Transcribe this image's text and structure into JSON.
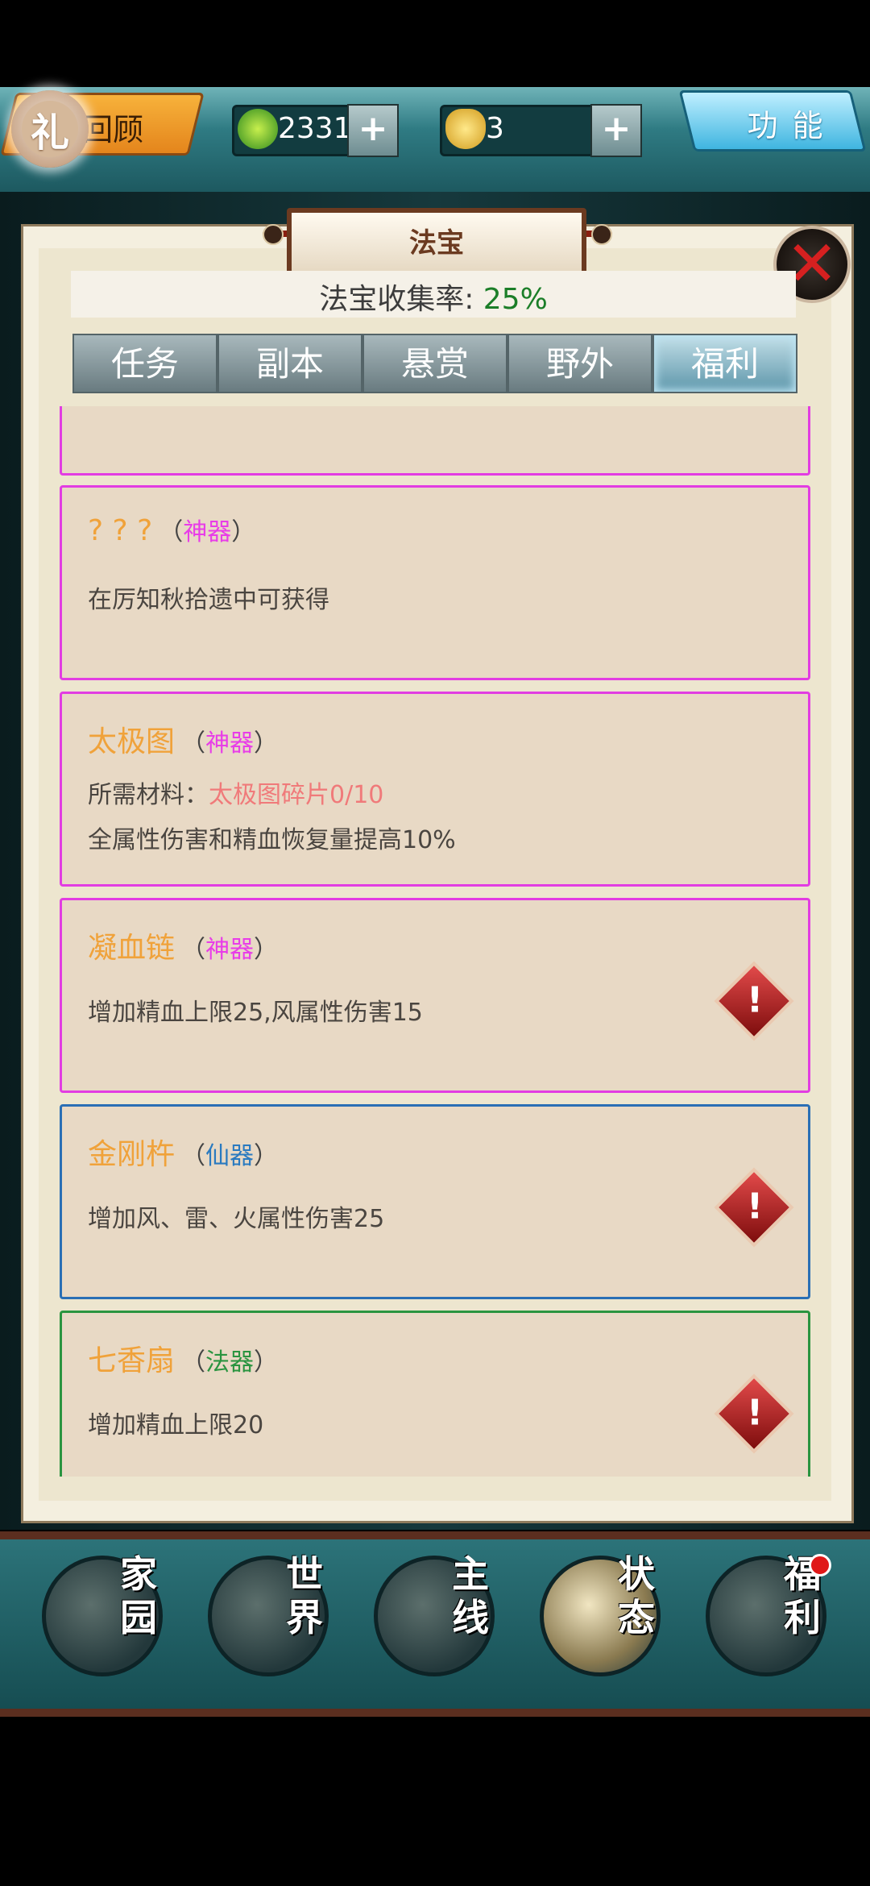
{
  "topbar": {
    "review_label": "回顾",
    "gift_label": "礼",
    "jade": {
      "value": "2331",
      "plus": "+"
    },
    "ingot": {
      "value": "3",
      "plus": "+"
    },
    "func_label": "功能"
  },
  "panel": {
    "title": "法宝",
    "close": "✕",
    "rate_label": "法宝收集率: ",
    "rate_value": "25%"
  },
  "tabs": [
    "任务",
    "副本",
    "悬赏",
    "野外",
    "福利"
  ],
  "active_tab": "福利",
  "items": [
    {
      "name": "? ? ?",
      "grade": "神器",
      "desc": "在厉知秋拾遗中可获得"
    },
    {
      "name": "太极图",
      "grade": "神器",
      "material_label": "所需材料：",
      "material": "太极图碎片0/10",
      "desc": "全属性伤害和精血恢复量提高10%"
    },
    {
      "name": "凝血链",
      "grade": "神器",
      "desc": "增加精血上限25,风属性伤害15",
      "alert": "!"
    },
    {
      "name": "金刚杵",
      "grade": "仙器",
      "desc": "增加风、雷、火属性伤害25",
      "alert": "!"
    },
    {
      "name": "七香扇",
      "grade": "法器",
      "desc": "增加精血上限20",
      "alert": "!"
    }
  ],
  "bottom_nav": [
    {
      "label": "家\n园"
    },
    {
      "label": "世\n界"
    },
    {
      "label": "主\n线"
    },
    {
      "label": "状\n态"
    },
    {
      "label": "福\n利"
    }
  ],
  "colors": {
    "shenqi": "#e83de8",
    "xianqi": "#2a7ac0",
    "faqi": "#2a9440",
    "item_name": "#f0a23a",
    "rate": "#1b7e28"
  }
}
